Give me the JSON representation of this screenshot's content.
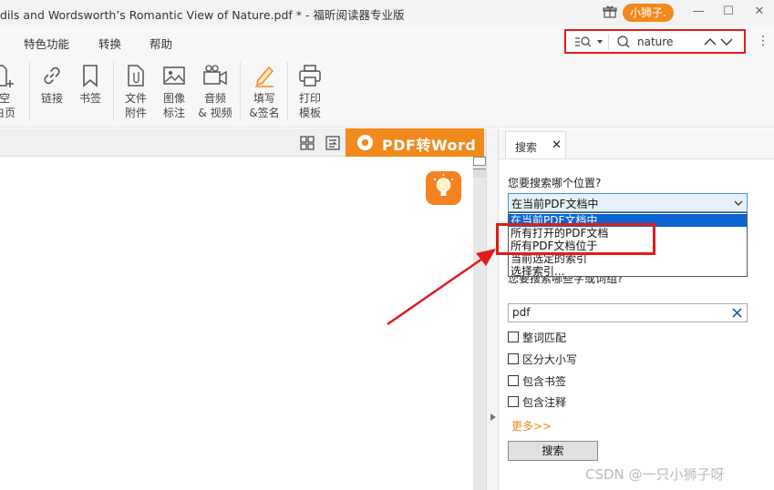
{
  "window": {
    "title": "dils and Wordsworth’s Romantic View of Nature.pdf * - 福昕阅读器专业版",
    "user": "小狮子."
  },
  "menu": [
    "特色功能",
    "转换",
    "帮助"
  ],
  "search": {
    "query": "nature"
  },
  "ribbon": [
    {
      "label1": "空",
      "label2": "白页"
    },
    {
      "label1": "链接",
      "label2": ""
    },
    {
      "label1": "书签",
      "label2": ""
    },
    {
      "label1": "文件",
      "label2": "附件"
    },
    {
      "label1": "图像",
      "label2": "标注"
    },
    {
      "label1": "音频",
      "label2": "& 视频"
    },
    {
      "label1": "填写",
      "label2": "&签名"
    },
    {
      "label1": "打印",
      "label2": "模板"
    }
  ],
  "promo": {
    "label": "PDF转Word"
  },
  "panel": {
    "tab": "搜索",
    "where_question": "您要搜索哪个位置?",
    "where_value": "在当前PDF文档中",
    "where_options": [
      "在当前PDF文档中",
      "所有打开的PDF文档",
      "所有PDF文档位于",
      "当前选定的索引",
      "选择索引..."
    ],
    "what_question": "您要搜索哪些字或词组?",
    "term": "pdf",
    "options": [
      "整词匹配",
      "区分大小写",
      "包含书签",
      "包含注释"
    ],
    "more": "更多>>",
    "search_button": "搜索"
  },
  "watermark": "CSDN @一只小狮子呀",
  "colors": {
    "accent": "#f08a1d",
    "highlight": "#e31b1b",
    "selection": "#0a64d1"
  }
}
